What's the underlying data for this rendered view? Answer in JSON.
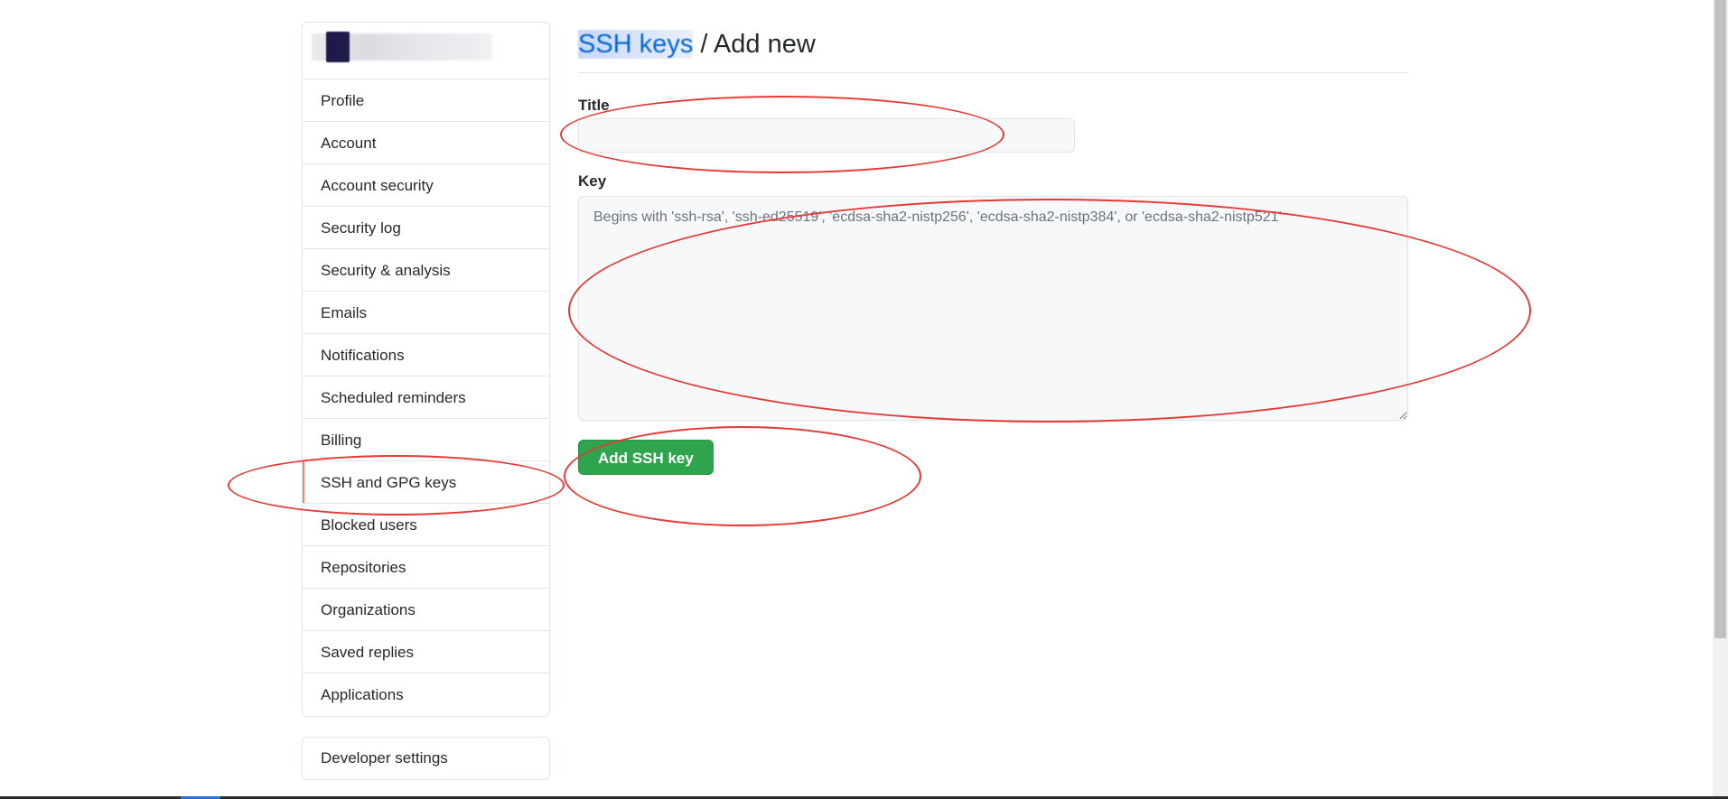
{
  "breadcrumb": {
    "parent_label": "SSH keys",
    "separator": " / ",
    "current_label": "Add new"
  },
  "sidebar": {
    "items": [
      {
        "label": "Profile"
      },
      {
        "label": "Account"
      },
      {
        "label": "Account security"
      },
      {
        "label": "Security log"
      },
      {
        "label": "Security & analysis"
      },
      {
        "label": "Emails"
      },
      {
        "label": "Notifications"
      },
      {
        "label": "Scheduled reminders"
      },
      {
        "label": "Billing"
      },
      {
        "label": "SSH and GPG keys",
        "active": true
      },
      {
        "label": "Blocked users"
      },
      {
        "label": "Repositories"
      },
      {
        "label": "Organizations"
      },
      {
        "label": "Saved replies"
      },
      {
        "label": "Applications"
      }
    ],
    "developer_settings_label": "Developer settings"
  },
  "form": {
    "title_label": "Title",
    "title_value": "",
    "key_label": "Key",
    "key_placeholder": "Begins with 'ssh-rsa', 'ssh-ed25519', 'ecdsa-sha2-nistp256', 'ecdsa-sha2-nistp384', or 'ecdsa-sha2-nistp521'",
    "submit_label": "Add SSH key"
  },
  "colors": {
    "accent_active": "#f9826c",
    "link": "#0366d6",
    "primary_button": "#2ea44f",
    "annotation": "#e53935"
  }
}
